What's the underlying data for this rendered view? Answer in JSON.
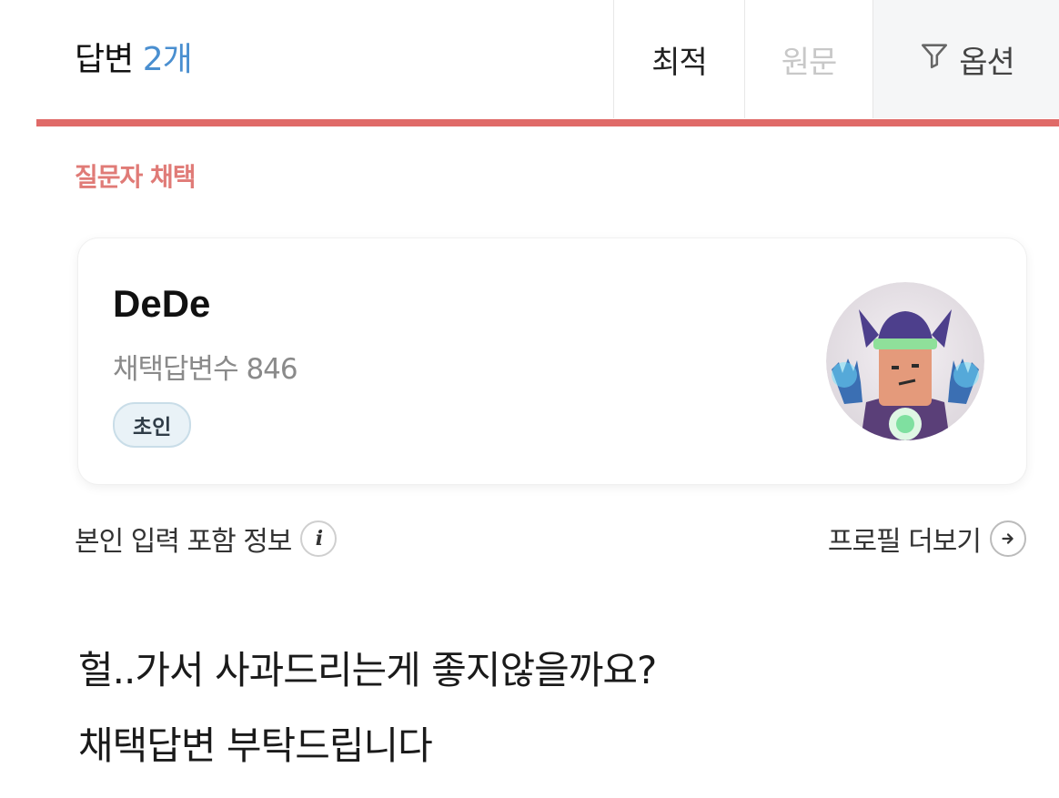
{
  "header": {
    "answers_label": "답변",
    "answers_count": "2개",
    "tabs": [
      {
        "label": "최적",
        "state": "active"
      },
      {
        "label": "원문",
        "state": "disabled"
      },
      {
        "label": "옵션",
        "icon": "filter-icon"
      }
    ]
  },
  "section_label": "질문자 채택",
  "profile": {
    "username": "DeDe",
    "adopted_answers": "채택답변수 846",
    "rank_badge": "초인",
    "avatar_icon": "character-avatar"
  },
  "info": {
    "self_input_label": "본인 입력 포함 정보",
    "info_icon": "info-icon",
    "more_profile_label": "프로필 더보기",
    "more_icon": "arrow-right-circle-icon"
  },
  "answer": {
    "lines": [
      "헐..가서 사과드리는게 좋지않을까요?",
      "채택답변 부탁드립니다"
    ]
  },
  "colors": {
    "accent_red": "#e06a68",
    "section_label": "#e07b77",
    "count_blue": "#4a8fd0",
    "badge_bg": "#e9f2f7"
  }
}
